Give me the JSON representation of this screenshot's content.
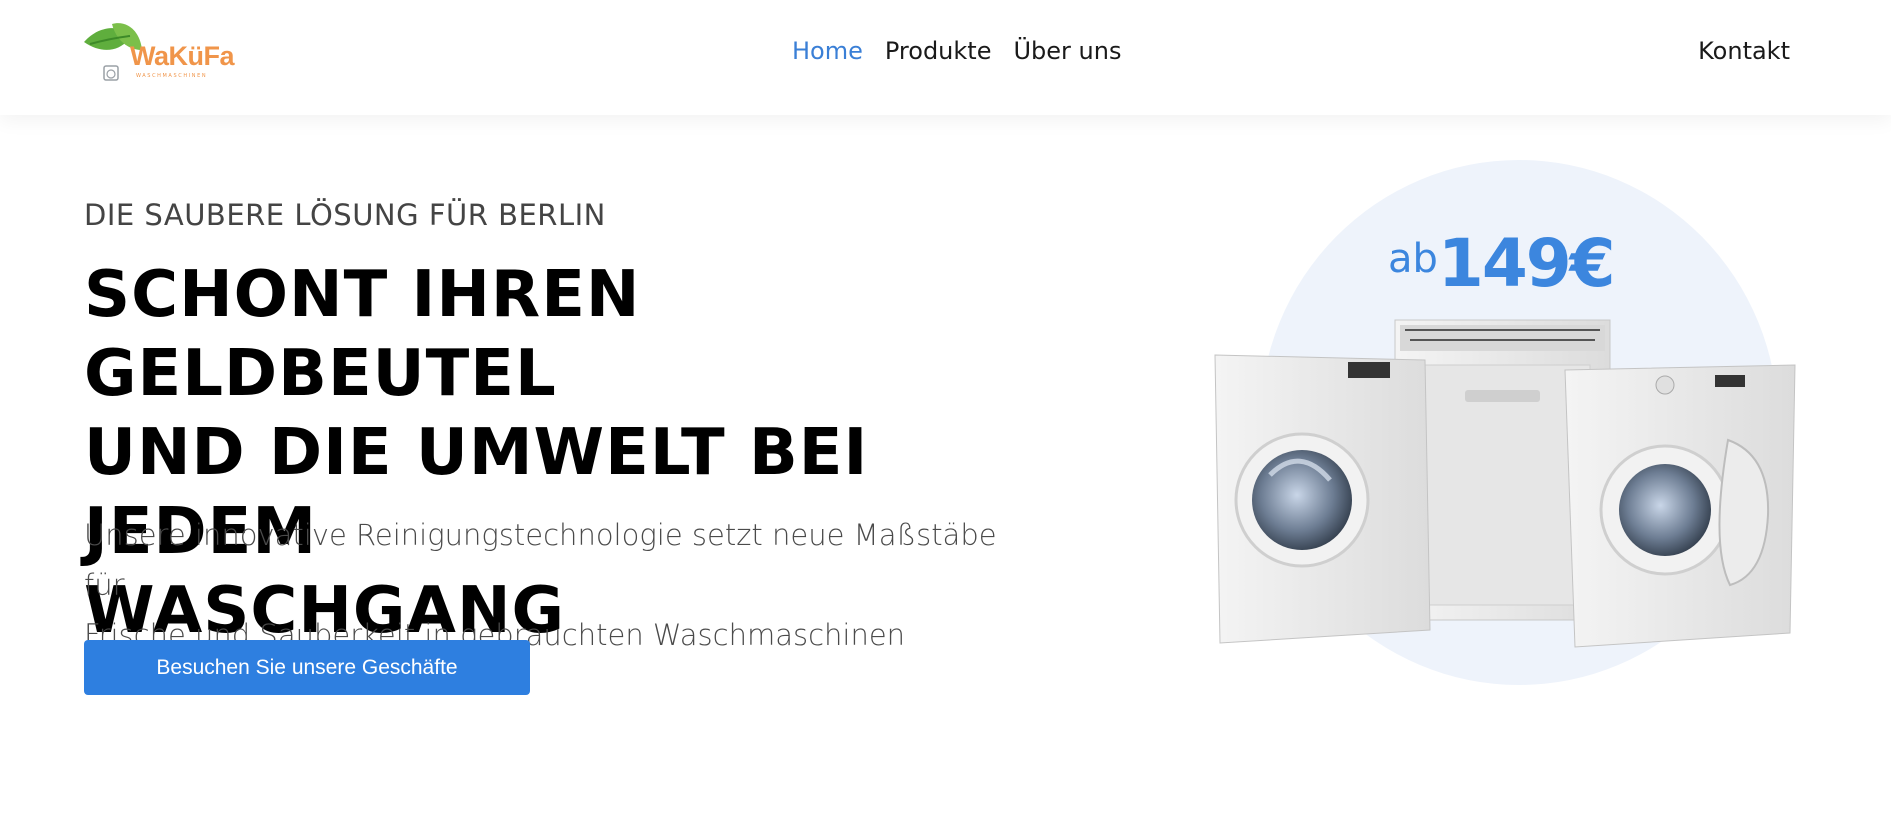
{
  "brand": {
    "name": "WaKüFa",
    "tagline": "WASCHMASCHINEN"
  },
  "nav": {
    "items": [
      {
        "label": "Home",
        "active": true
      },
      {
        "label": "Produkte",
        "active": false
      },
      {
        "label": "Über uns",
        "active": false
      }
    ],
    "contact": "Kontakt"
  },
  "hero": {
    "eyebrow": "DIE SAUBERE LÖSUNG FÜR BERLIN",
    "headline_lines": [
      "SCHONT IHREN GELDBEUTEL",
      "UND DIE UMWELT BEI JEDEM",
      "WASCHGANG"
    ],
    "subtext_lines": [
      "Unsere innovative Reinigungstechnologie setzt neue Maßstäbe für",
      "Frische und Sauberkeit in gebrauchten Waschmaschinen"
    ],
    "cta_label": "Besuchen Sie unsere Geschäfte",
    "price_prefix": "ab",
    "price_amount": "149€"
  },
  "colors": {
    "accent": "#2e7fe0",
    "nav_active": "#3a7fd6",
    "logo_orange": "#f0954a",
    "logo_green": "#6ab04c",
    "circle_bg": "#eef3fb"
  }
}
